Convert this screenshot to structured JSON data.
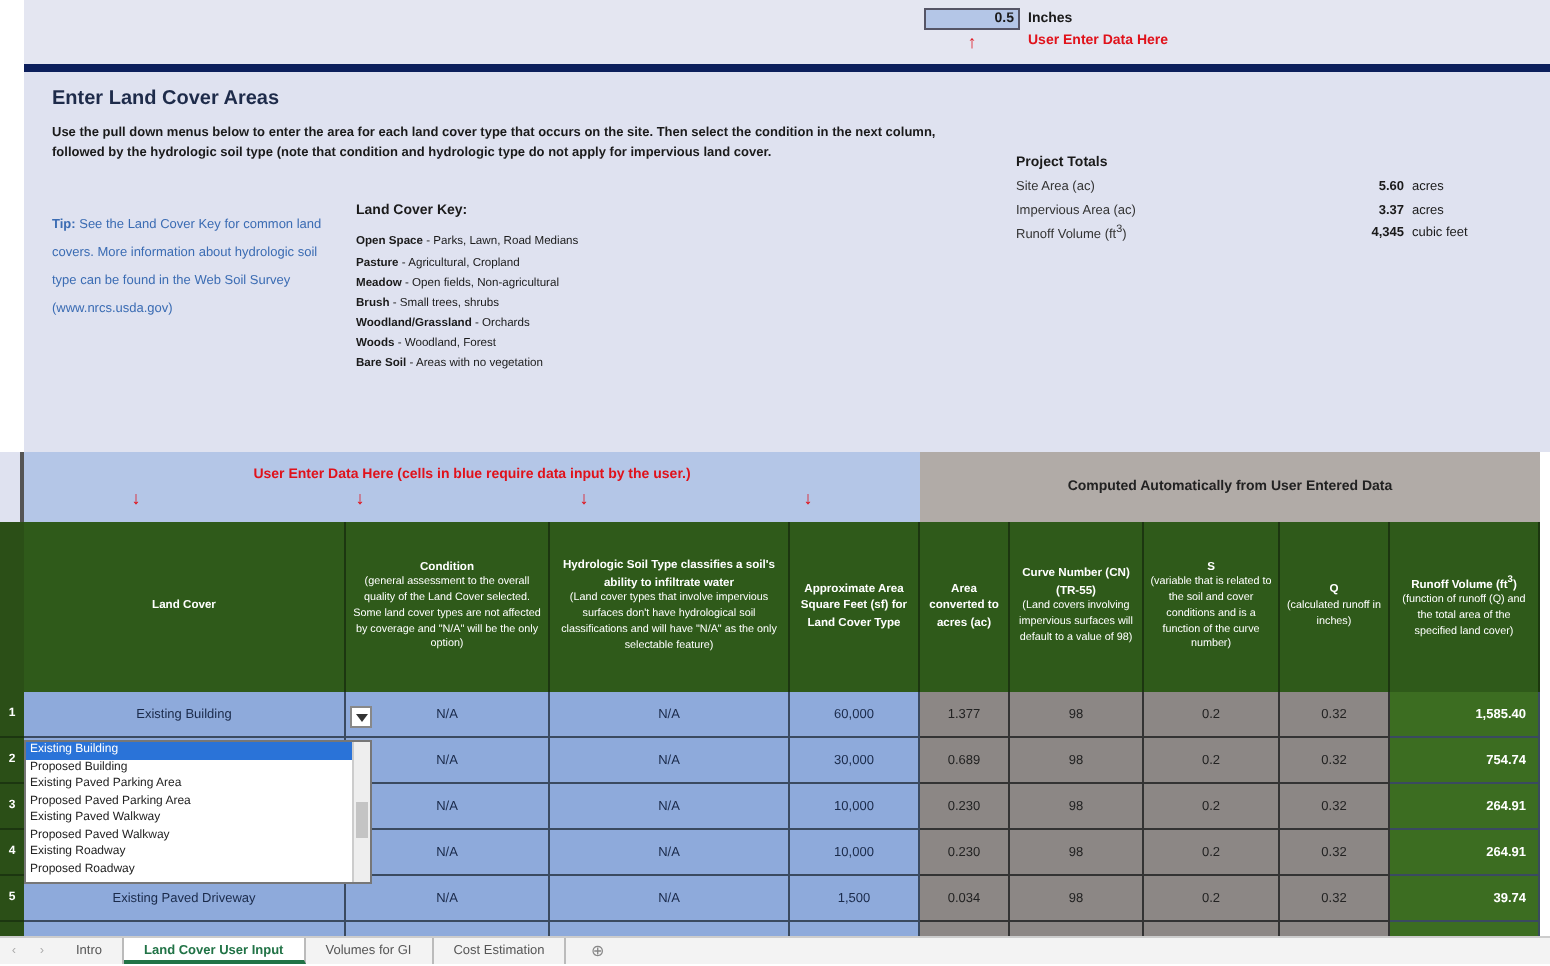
{
  "rainfall": {
    "value": "0.5",
    "unit": "Inches",
    "arrow": "↑",
    "note": "User Enter Data Here"
  },
  "section": {
    "title": "Enter Land Cover Areas",
    "instructions": "Use the pull down menus below to enter the area for each land cover type that occurs on the site.  Then select the condition in the next column, followed by the hydrologic soil type (note that condition and hydrologic type do not apply for impervious land cover.",
    "tip": "**Tip:**  See the Land Cover Key for common land covers.  More information about hydrologic soil type can be found in the Web Soil Survey (www.nrcs.usda.gov)"
  },
  "land_cover_key": {
    "title": "Land Cover Key:",
    "items": [
      {
        "term": "Open Space",
        "desc": "- Parks, Lawn, Road Medians"
      },
      {
        "term": "Pasture",
        "desc": "- Agricultural, Cropland"
      },
      {
        "term": "Meadow",
        "desc": "- Open fields, Non-agricultural"
      },
      {
        "term": "Brush",
        "desc": "- Small trees, shrubs"
      },
      {
        "term": "Woodland/Grassland",
        "desc": "- Orchards"
      },
      {
        "term": "Woods",
        "desc": "- Woodland, Forest"
      },
      {
        "term": "Bare Soil",
        "desc": "- Areas with no vegetation"
      }
    ]
  },
  "project_totals": {
    "title": "Project Totals",
    "rows": [
      {
        "label": "Site Area (ac)",
        "value": "5.60",
        "unit": "acres"
      },
      {
        "label": "Impervious Area (ac)",
        "value": "3.37",
        "unit": "acres"
      },
      {
        "label": "Runoff Volume (ft$^{3}$)",
        "value": "4,345",
        "unit": "cubic feet"
      }
    ]
  },
  "table": {
    "input_banner": {
      "text": "User Enter Data Here (cells in blue require data input by the user.)",
      "arrows": [
        "↓",
        "↓",
        "↓",
        "↓"
      ]
    },
    "computed_banner": "Computed Automatically from User Entered Data",
    "columns": [
      {
        "kind": "input",
        "title": "Land Cover"
      },
      {
        "kind": "input",
        "title": "Condition",
        "note": "(general assessment to the overall quality of the Land Cover selected. Some land cover types are not affected by coverage and \"N/A\" will be the only option)"
      },
      {
        "kind": "input",
        "title": "Hydrologic Soil Type classifies a soil's ability to infiltrate water",
        "note": "(Land cover types that involve impervious surfaces don't have hydrological soil classifications and will have \"N/A\" as the only selectable feature)"
      },
      {
        "kind": "input",
        "title": "Approximate Area Square Feet (sf) for Land Cover Type"
      },
      {
        "kind": "computed",
        "title": "Area converted to acres (ac)"
      },
      {
        "kind": "computed",
        "title": "Curve Number (CN) (TR-55)",
        "note": "(Land covers involving impervious surfaces will default to a value of 98)"
      },
      {
        "kind": "computed",
        "title": "S",
        "note": "(variable that is related to the soil and cover conditions and is a function of the curve number)"
      },
      {
        "kind": "computed",
        "title": "Q",
        "note": "(calculated runoff in inches)"
      },
      {
        "kind": "result",
        "title": "Runoff Volume (ft$^{3}$)",
        "note": "(function of runoff (Q) and the total area of the specified land cover)"
      }
    ],
    "rows": [
      {
        "number": "1",
        "dropdown_open": true,
        "cells": [
          "Existing Building",
          "N/A",
          "N/A",
          "60,000",
          "1.377",
          "98",
          "0.2",
          "0.32",
          "1,585.40"
        ]
      },
      {
        "number": "2",
        "cells": [
          null,
          "N/A",
          "N/A",
          "30,000",
          "0.689",
          "98",
          "0.2",
          "0.32",
          "754.74"
        ]
      },
      {
        "number": "3",
        "cells": [
          null,
          "N/A",
          "N/A",
          "10,000",
          "0.230",
          "98",
          "0.2",
          "0.32",
          "264.91"
        ]
      },
      {
        "number": "4",
        "cells": [
          null,
          "N/A",
          "N/A",
          "10,000",
          "0.230",
          "98",
          "0.2",
          "0.32",
          "264.91"
        ]
      },
      {
        "number": "5",
        "cells": [
          "Existing Paved Driveway",
          "N/A",
          "N/A",
          "1,500",
          "0.034",
          "98",
          "0.2",
          "0.32",
          "39.74"
        ]
      }
    ],
    "dropdown_options": [
      {
        "label": "Existing Building",
        "selected": true
      },
      {
        "label": "Proposed Building",
        "selected": false
      },
      {
        "label": "Existing Paved Parking Area",
        "selected": false
      },
      {
        "label": "Proposed Paved Parking Area",
        "selected": false
      },
      {
        "label": "Existing Paved Walkway",
        "selected": false
      },
      {
        "label": "Proposed Paved Walkway",
        "selected": false
      },
      {
        "label": "Existing Roadway",
        "selected": false
      },
      {
        "label": "Proposed Roadway",
        "selected": false
      }
    ]
  },
  "sheet_nav": [
    "‹",
    "›"
  ],
  "sheet_tabs": [
    {
      "label": "Intro",
      "selected": false
    },
    {
      "label": "Land Cover User Input",
      "selected": true
    },
    {
      "label": "Volumes for GI",
      "selected": false
    },
    {
      "label": "Cost Estimation",
      "selected": false
    }
  ],
  "add_sheet": "⊕"
}
